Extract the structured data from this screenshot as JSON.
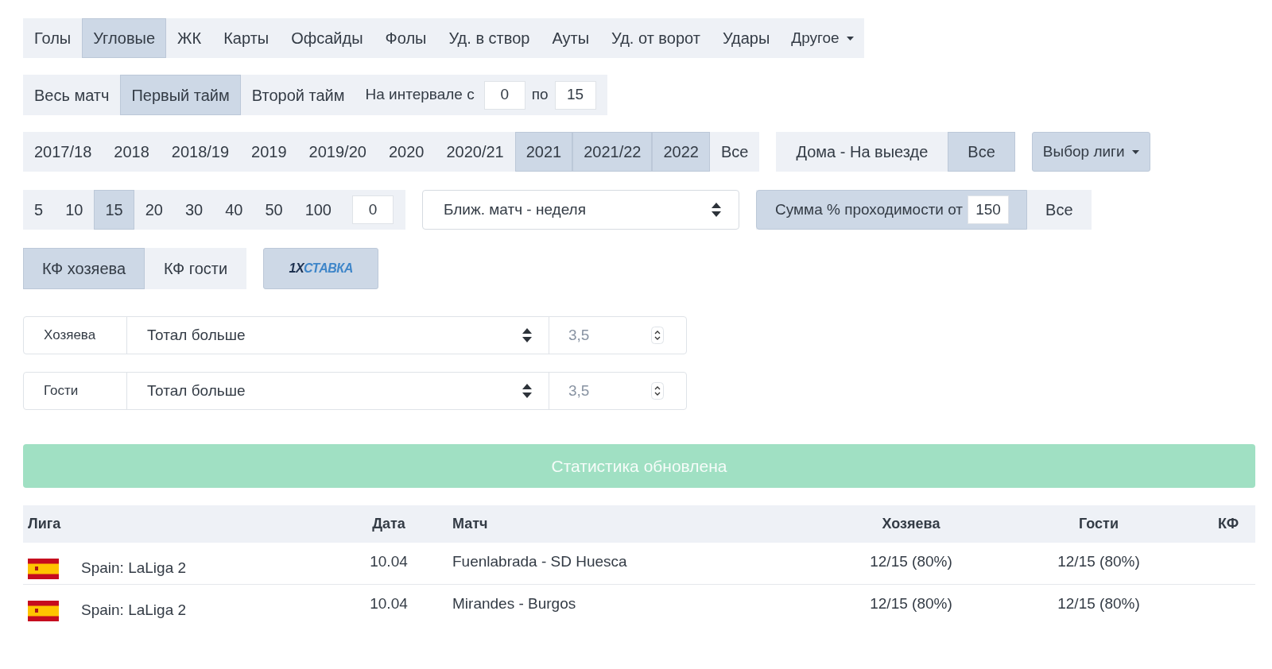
{
  "stat_tabs": [
    {
      "label": "Голы",
      "selected": false
    },
    {
      "label": "Угловые",
      "selected": true
    },
    {
      "label": "ЖК",
      "selected": false
    },
    {
      "label": "Карты",
      "selected": false
    },
    {
      "label": "Офсайды",
      "selected": false
    },
    {
      "label": "Фолы",
      "selected": false
    },
    {
      "label": "Уд. в створ",
      "selected": false
    },
    {
      "label": "Ауты",
      "selected": false
    },
    {
      "label": "Уд. от ворот",
      "selected": false
    },
    {
      "label": "Удары",
      "selected": false
    }
  ],
  "more_menu": {
    "label": "Другое"
  },
  "period": {
    "tabs": [
      {
        "label": "Весь матч",
        "selected": false
      },
      {
        "label": "Первый тайм",
        "selected": true
      },
      {
        "label": "Второй тайм",
        "selected": false
      }
    ],
    "interval_label": "На интервале с",
    "from": "0",
    "to_label": "по",
    "to": "15"
  },
  "seasons": [
    {
      "label": "2017/18",
      "selected": false
    },
    {
      "label": "2018",
      "selected": false
    },
    {
      "label": "2018/19",
      "selected": false
    },
    {
      "label": "2019",
      "selected": false
    },
    {
      "label": "2019/20",
      "selected": false
    },
    {
      "label": "2020",
      "selected": false
    },
    {
      "label": "2020/21",
      "selected": false
    },
    {
      "label": "2021",
      "selected": true
    },
    {
      "label": "2021/22",
      "selected": true
    },
    {
      "label": "2022",
      "selected": true
    },
    {
      "label": "Все",
      "selected": false
    }
  ],
  "location": [
    {
      "label": "Дома - На выезде",
      "selected": false
    },
    {
      "label": "Все",
      "selected": true
    }
  ],
  "league_button": {
    "label": "Выбор лиги"
  },
  "last_n": {
    "options": [
      {
        "label": "5",
        "selected": false
      },
      {
        "label": "10",
        "selected": false
      },
      {
        "label": "15",
        "selected": true
      },
      {
        "label": "20",
        "selected": false
      },
      {
        "label": "30",
        "selected": false
      },
      {
        "label": "40",
        "selected": false
      },
      {
        "label": "50",
        "selected": false
      },
      {
        "label": "100",
        "selected": false
      }
    ],
    "custom": "0"
  },
  "period_select": {
    "value": "Ближ. матч - неделя"
  },
  "sum_filter": {
    "label": "Сумма % проходимости от",
    "value": "150",
    "selected": true
  },
  "sum_all": {
    "label": "Все",
    "selected": false
  },
  "odds_tabs": [
    {
      "label": "КФ хозяева",
      "selected": true
    },
    {
      "label": "КФ гости",
      "selected": false
    }
  ],
  "bookmaker": {
    "logo_prefix": "1X",
    "logo_suffix": "СТАВКА",
    "selected": true
  },
  "filters": [
    {
      "label": "Хозяева",
      "select": "Тотал больше",
      "placeholder": "3,5"
    },
    {
      "label": "Гости",
      "select": "Тотал больше",
      "placeholder": "3,5"
    }
  ],
  "status_button": {
    "label": "Статистика обновлена",
    "disabled": true
  },
  "table": {
    "columns": [
      "Лига",
      "Дата",
      "Матч",
      "Хозяева",
      "Гости",
      "КФ"
    ],
    "rows": [
      {
        "league": "Spain: LaLiga 2",
        "date": "10.04",
        "match": "Fuenlabrada - SD Huesca",
        "home": "12/15 (80%)",
        "away": "12/15 (80%)"
      },
      {
        "league": "Spain: LaLiga 2",
        "date": "10.04",
        "match": "Mirandes - Burgos",
        "home": "12/15 (80%)",
        "away": "12/15 (80%)"
      }
    ]
  }
}
